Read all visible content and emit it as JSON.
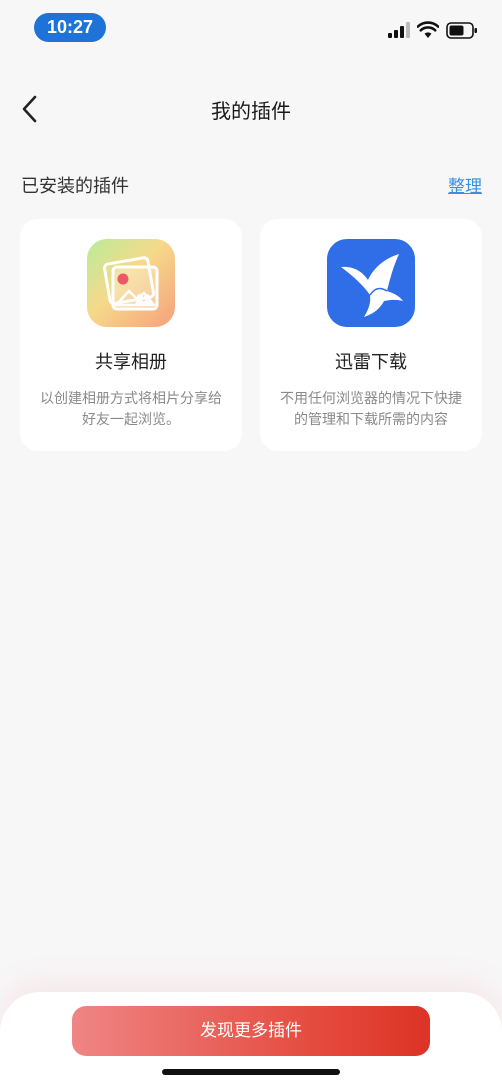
{
  "status_bar": {
    "time": "10:27",
    "time_pill_color": "#1e73d8",
    "icons": [
      "signal-icon",
      "wifi-icon",
      "battery-icon"
    ]
  },
  "nav": {
    "back_icon": "chevron-left-icon",
    "title": "我的插件"
  },
  "installed": {
    "section_title": "已安装的插件",
    "manage_label": "整理",
    "manage_color": "#3a8ee6",
    "plugins": [
      {
        "name": "共享相册",
        "description": "以创建相册方式将相片分享给好友一起浏览。",
        "icon": "shared-album-icon"
      },
      {
        "name": "迅雷下载",
        "description": "不用任何浏览器的情况下快捷的管理和下载所需的内容",
        "icon": "xunlei-bird-icon",
        "icon_color": "#2f6ee6"
      }
    ]
  },
  "footer": {
    "discover_label": "发现更多插件",
    "button_color": "#e4493c"
  }
}
